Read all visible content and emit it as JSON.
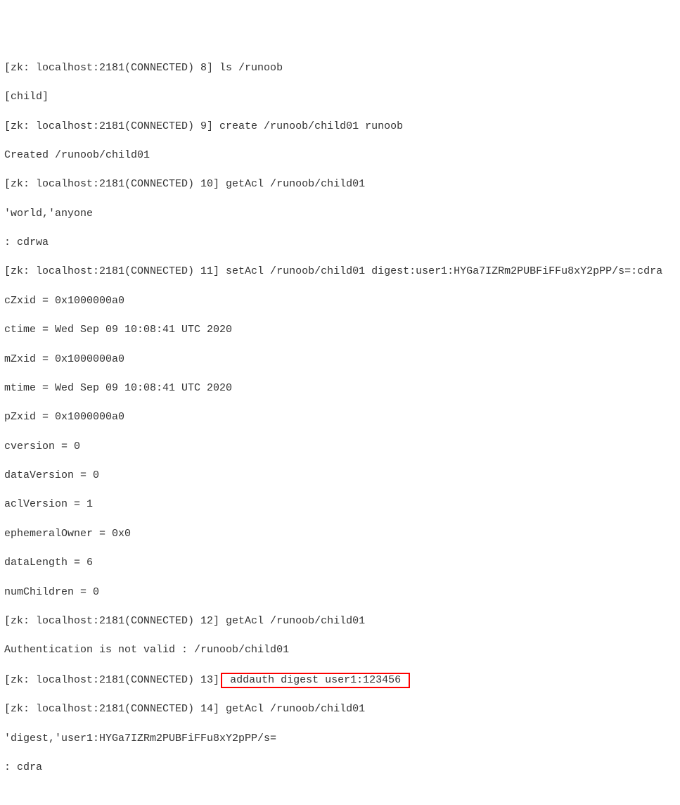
{
  "terminal": {
    "lines": [
      "[zk: localhost:2181(CONNECTED) 8] ls /runoob",
      "[child]",
      "[zk: localhost:2181(CONNECTED) 9] create /runoob/child01 runoob",
      "Created /runoob/child01",
      "[zk: localhost:2181(CONNECTED) 10] getAcl /runoob/child01",
      "'world,'anyone",
      ": cdrwa",
      "[zk: localhost:2181(CONNECTED) 11] setAcl /runoob/child01 digest:user1:HYGa7IZRm2PUBFiFFu8xY2pPP/s=:cdra",
      "cZxid = 0x1000000a0",
      "ctime = Wed Sep 09 10:08:41 UTC 2020",
      "mZxid = 0x1000000a0",
      "mtime = Wed Sep 09 10:08:41 UTC 2020",
      "pZxid = 0x1000000a0",
      "cversion = 0",
      "dataVersion = 0",
      "aclVersion = 1",
      "ephemeralOwner = 0x0",
      "dataLength = 6",
      "numChildren = 0",
      "[zk: localhost:2181(CONNECTED) 12] getAcl /runoob/child01",
      "Authentication is not valid : /runoob/child01"
    ],
    "line_highlight_prefix": "[zk: localhost:2181(CONNECTED) 13]",
    "line_highlight_box": " addauth digest user1:123456 ",
    "lines_after": [
      "[zk: localhost:2181(CONNECTED) 14] getAcl /runoob/child01",
      "'digest,'user1:HYGa7IZRm2PUBFiFFu8xY2pPP/s=",
      ": cdra"
    ]
  }
}
